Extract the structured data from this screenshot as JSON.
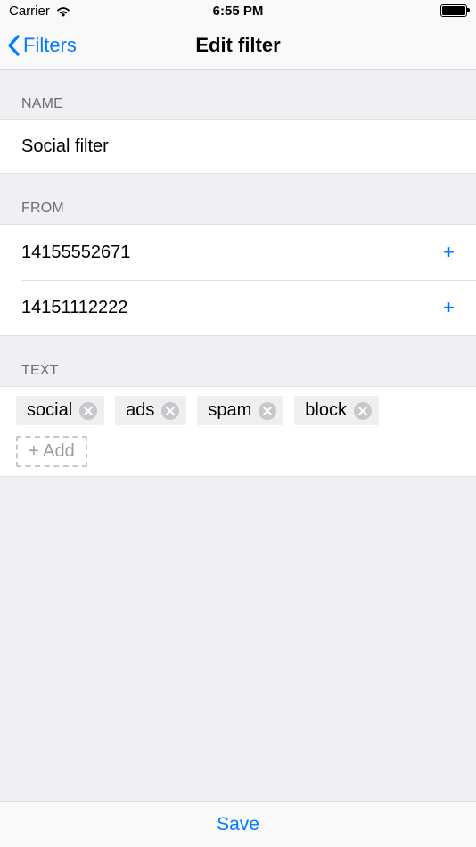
{
  "status": {
    "carrier": "Carrier",
    "time": "6:55 PM"
  },
  "nav": {
    "back_label": "Filters",
    "title": "Edit filter"
  },
  "sections": {
    "name": {
      "header": "NAME",
      "value": "Social filter"
    },
    "from": {
      "header": "FROM",
      "items": [
        "14155552671",
        "14151112222"
      ],
      "add_symbol": "+"
    },
    "text": {
      "header": "TEXT",
      "tags": [
        "social",
        "ads",
        "spam",
        "block"
      ],
      "add_label": "+ Add"
    }
  },
  "footer": {
    "save_label": "Save"
  }
}
